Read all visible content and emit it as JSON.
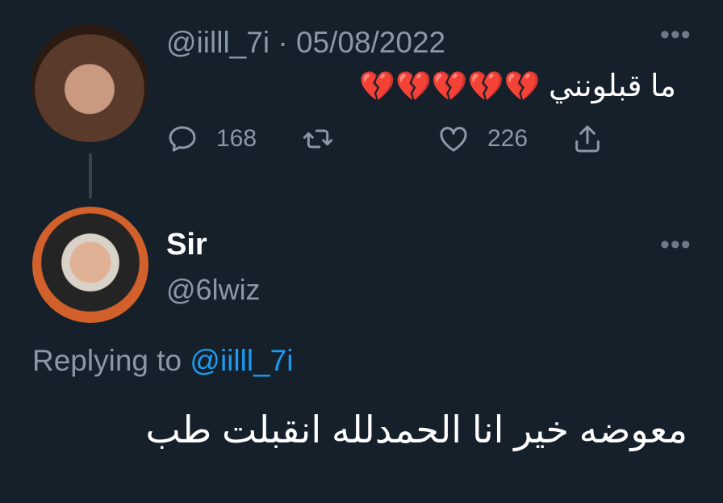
{
  "tweet1": {
    "handle": "@iilll_7i",
    "separator": "·",
    "date": "05/08/2022",
    "text": "ما قبلونني",
    "emojis": "💔💔💔💔💔",
    "replies": "168",
    "likes": "226"
  },
  "tweet2": {
    "name": "Sir",
    "handle": "@6lwiz",
    "replying_label": "Replying to",
    "replying_handle": "@iilll_7i",
    "text": "معوضه خير انا الحمدلله انقبلت طب"
  },
  "icons": {
    "reply": "reply-icon",
    "retweet": "retweet-icon",
    "like": "heart-icon",
    "share": "share-icon",
    "more": "more-icon"
  },
  "colors": {
    "background": "#15202b",
    "secondary_text": "#8b98a5",
    "link": "#1d9bf0"
  }
}
